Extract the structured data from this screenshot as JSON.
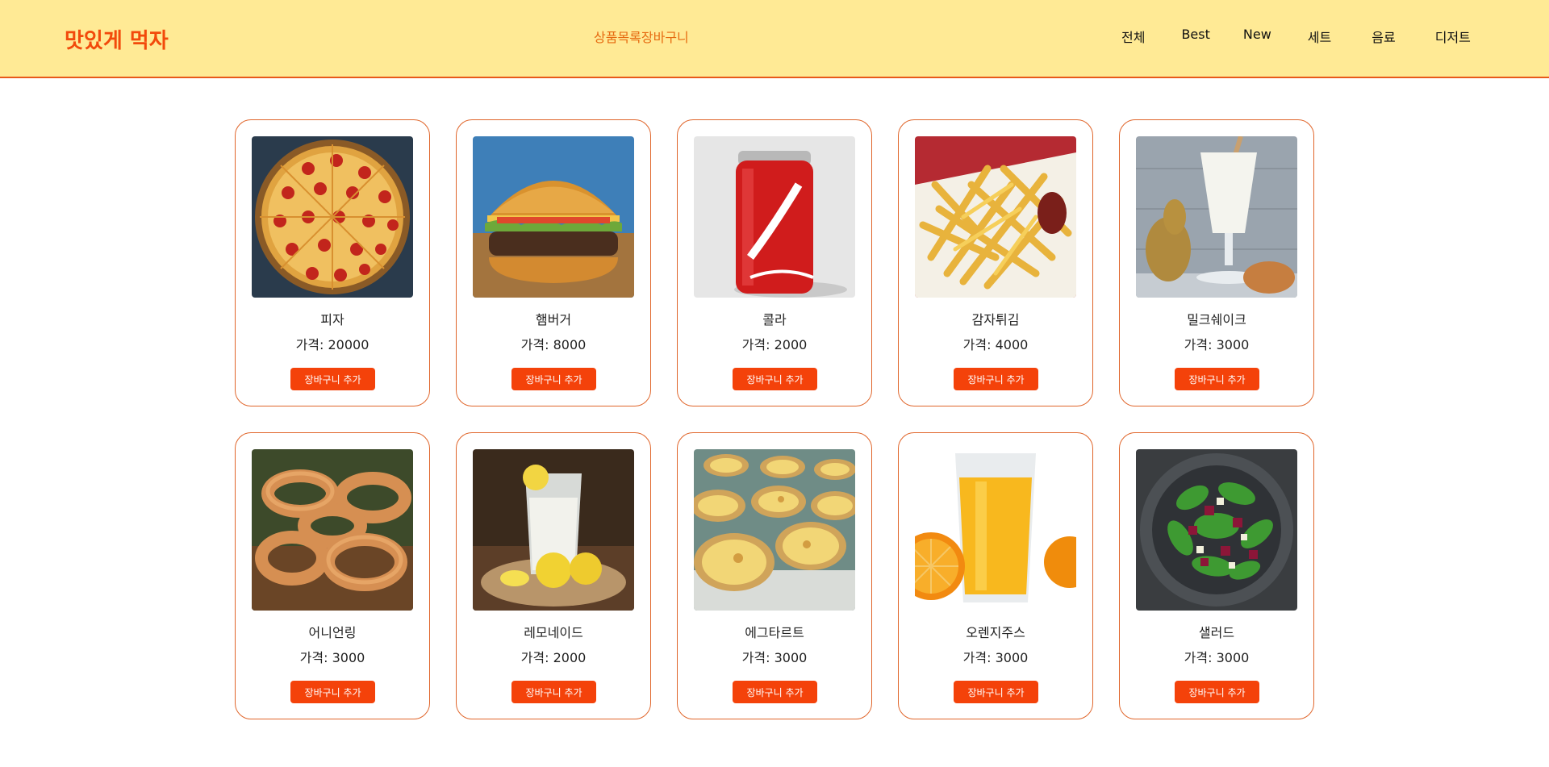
{
  "header": {
    "logo": "맛있게 먹자",
    "links": {
      "products": "상품목록",
      "cart": "장바구니"
    },
    "nav": [
      "전체",
      "Best",
      "New",
      "세트",
      "음료",
      "디저트"
    ],
    "background_color": "#ffea95",
    "accent_color": "#f24a0b"
  },
  "products": [
    {
      "name": "피자",
      "price": "가격: 20000",
      "button": "장바구니 추가",
      "image": "pizza"
    },
    {
      "name": "햄버거",
      "price": "가격: 8000",
      "button": "장바구니 추가",
      "image": "burger"
    },
    {
      "name": "콜라",
      "price": "가격: 2000",
      "button": "장바구니 추가",
      "image": "cola"
    },
    {
      "name": "감자튀김",
      "price": "가격: 4000",
      "button": "장바구니 추가",
      "image": "fries"
    },
    {
      "name": "밀크쉐이크",
      "price": "가격: 3000",
      "button": "장바구니 추가",
      "image": "milkshake"
    },
    {
      "name": "어니언링",
      "price": "가격: 3000",
      "button": "장바구니 추가",
      "image": "onion-rings"
    },
    {
      "name": "레모네이드",
      "price": "가격: 2000",
      "button": "장바구니 추가",
      "image": "lemonade"
    },
    {
      "name": "에그타르트",
      "price": "가격: 3000",
      "button": "장바구니 추가",
      "image": "egg-tart"
    },
    {
      "name": "오렌지주스",
      "price": "가격: 3000",
      "button": "장바구니 추가",
      "image": "orange-juice"
    },
    {
      "name": "샐러드",
      "price": "가격: 3000",
      "button": "장바구니 추가",
      "image": "salad"
    }
  ]
}
